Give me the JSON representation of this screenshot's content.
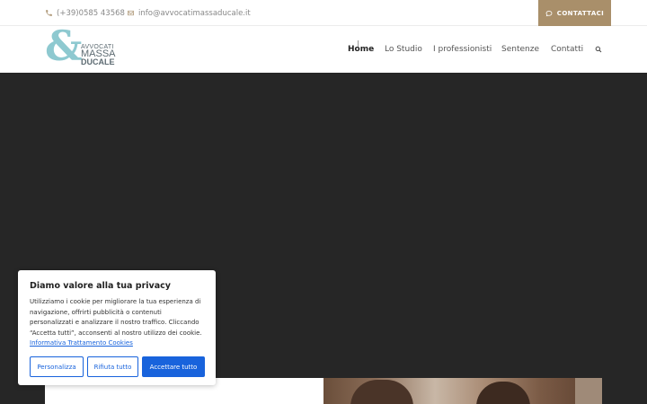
{
  "topbar": {
    "phone": "(+39)0585 43568",
    "email": "info@avvocatimassaducale.it",
    "separator": "·",
    "cta_label": "CONTATTACI",
    "phone_icon": "phone-icon",
    "mail_icon": "mail-icon",
    "cta_icon": "chat-bubble-icon"
  },
  "logo": {
    "symbol": "&",
    "line1": "AVVOCATI",
    "line2": "MASSA",
    "line3": "DUCALE"
  },
  "nav": {
    "items": [
      {
        "label": "Home",
        "active": true
      },
      {
        "label": "Lo Studio",
        "active": false
      },
      {
        "label": "I professionisti",
        "active": false
      },
      {
        "label": "Sentenze",
        "active": false
      },
      {
        "label": "Contatti",
        "active": false
      }
    ],
    "search_icon": "search-icon"
  },
  "cookie": {
    "title": "Diamo valore alla tua privacy",
    "body": "Utilizziamo i cookie per migliorare la tua esperienza di navigazione, offrirti pubblicità o contenuti personalizzati e analizzare il nostro traffico. Cliccando “Accetta tutti”, acconsenti al nostro utilizzo dei cookie.",
    "link": "Informativa Trattamento Cookies",
    "buttons": {
      "customize": "Personalizza",
      "reject": "Rifiuta tutto",
      "accept": "Accettare tutto"
    }
  },
  "colors": {
    "accent": "#a98f6a",
    "logo": "#8ec9d0",
    "hero_bg": "#262626",
    "cookie_primary": "#1863dc"
  }
}
